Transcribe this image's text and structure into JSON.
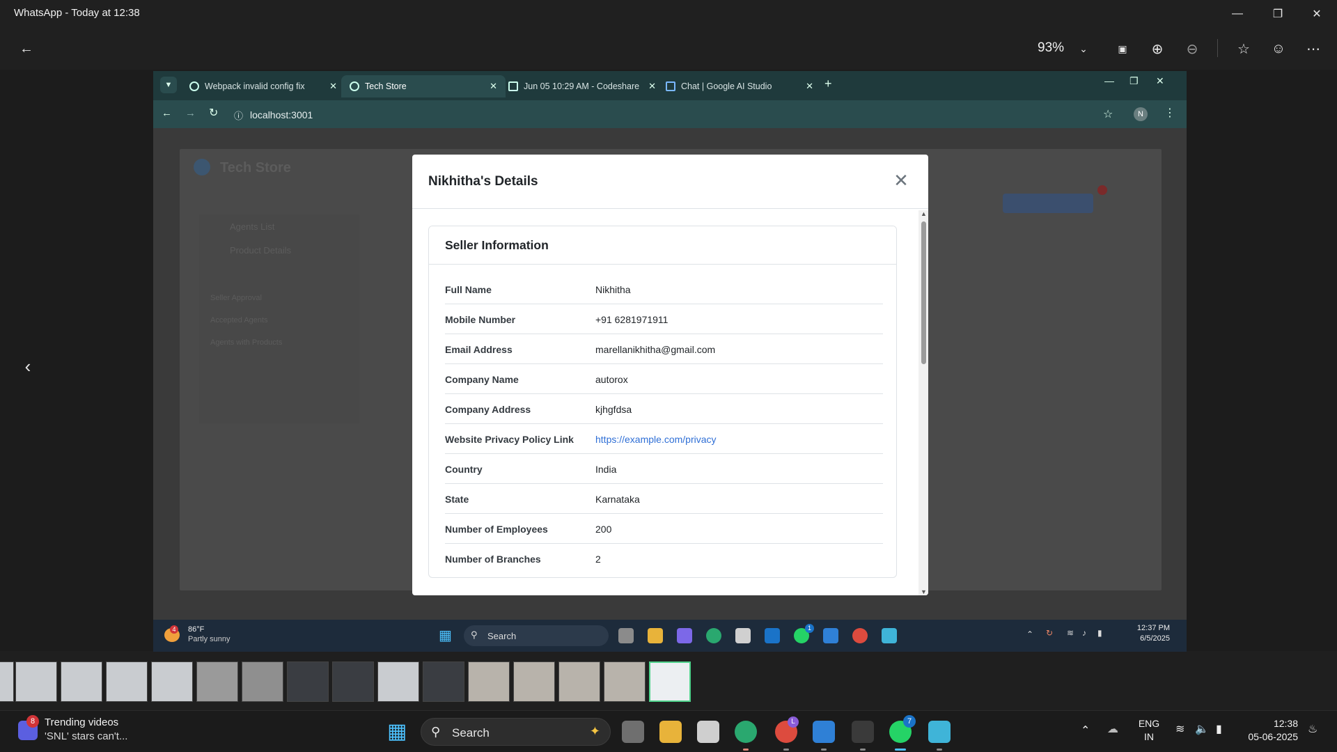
{
  "viewer": {
    "title": "WhatsApp - Today at 12:38",
    "zoom": "93%",
    "icons": [
      "back-arrow-icon",
      "zoom-dropdown-icon",
      "actual-size-icon",
      "zoom-in-icon",
      "zoom-out-icon",
      "favorite-star-icon",
      "emoji-icon",
      "more-icon",
      "prev-image-icon"
    ]
  },
  "browser": {
    "tabs": [
      {
        "label": "Webpack invalid config fix"
      },
      {
        "label": "Tech Store"
      },
      {
        "label": "Jun 05 10:29 AM - Codeshare"
      },
      {
        "label": "Chat | Google AI Studio"
      }
    ],
    "url": "localhost:3001",
    "profile_initial": "N"
  },
  "modal": {
    "title": "Nikhitha's Details",
    "card_title": "Seller Information",
    "rows": [
      {
        "label": "Full Name",
        "value": "Nikhitha"
      },
      {
        "label": "Mobile Number",
        "value": "+91 6281971911"
      },
      {
        "label": "Email Address",
        "value": "marellanikhitha@gmail.com"
      },
      {
        "label": "Company Name",
        "value": "autorox"
      },
      {
        "label": "Company Address",
        "value": "kjhgfdsa"
      },
      {
        "label": "Website Privacy Policy Link",
        "value": "https://example.com/privacy"
      },
      {
        "label": "Country",
        "value": "India"
      },
      {
        "label": "State",
        "value": "Karnataka"
      },
      {
        "label": "Number of Employees",
        "value": "200"
      },
      {
        "label": "Number of Branches",
        "value": "2"
      }
    ]
  },
  "background_app": {
    "brand": "Tech Store",
    "sidebar_items": [
      "Agents List",
      "Product Details",
      "Seller Approval",
      "Accepted Agents",
      "Agents with Products"
    ]
  },
  "inner_taskbar": {
    "weather_temp": "86°F",
    "weather_desc": "Partly sunny",
    "weather_badge": "4",
    "search": "Search",
    "time": "12:37 PM",
    "date": "6/5/2025",
    "whatsapp_badge": "1"
  },
  "taskbar": {
    "news_badge": "8",
    "news_title": "Trending videos",
    "news_sub": "'SNL' stars can't...",
    "search": "Search",
    "lang": "ENG",
    "region": "IN",
    "time": "12:38",
    "date": "05-06-2025",
    "whatsapp_badge": "7",
    "chrome_badge": "L"
  },
  "colors": {
    "browser_tabbar": "#1f3a3c",
    "browser_toolbar": "#2a4c4e",
    "link": "#2f6fd6",
    "filmstrip_selected": "#4fd28b"
  }
}
